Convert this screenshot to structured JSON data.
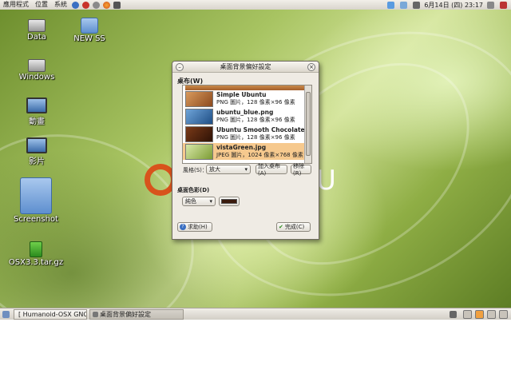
{
  "topbar": {
    "menus": [
      "應用程式",
      "位置",
      "系統"
    ],
    "clock": "6月14日 (四) 23:17"
  },
  "desktop_icons": [
    {
      "label": "Data"
    },
    {
      "label": "NEW SS"
    },
    {
      "label": "Windows"
    },
    {
      "label": "動畫"
    },
    {
      "label": "影片"
    },
    {
      "label": "Screenshot"
    },
    {
      "label": "OSX3.3.tar.gz"
    }
  ],
  "window": {
    "title": "桌面背景偏好設定",
    "wallpaper_section": "桌布(W)",
    "wallpapers": [
      {
        "name": "Simple Ubuntu",
        "info": "PNG 圖片，128 像素×96 像素",
        "color": "#b5703a"
      },
      {
        "name": "ubuntu_blue.png",
        "info": "PNG 圖片，128 像素×96 像素",
        "color": "#3f78b0"
      },
      {
        "name": "Ubuntu Smooth Chocolate",
        "info": "PNG 圖片，128 像素×96 像素",
        "color": "#5a2a12"
      },
      {
        "name": "vistaGreen.jpg",
        "info": "JPEG 圖片，1024 像素×768 像素",
        "color": "#9fbf55",
        "selected": true
      }
    ],
    "style_label": "風格(S)：",
    "style_value": "放大",
    "add_button": "加入桌布(A)",
    "remove_button": "移除(R)",
    "color_section": "桌面色彩(D)",
    "color_mode": "純色",
    "color_swatch": "#3a1a0c",
    "help_button": "求助(H)",
    "close_button": "完成(C)"
  },
  "taskbar": {
    "tasks": [
      "[ Humanoid-OSX GNOM…",
      "桌面背景偏好設定"
    ]
  }
}
